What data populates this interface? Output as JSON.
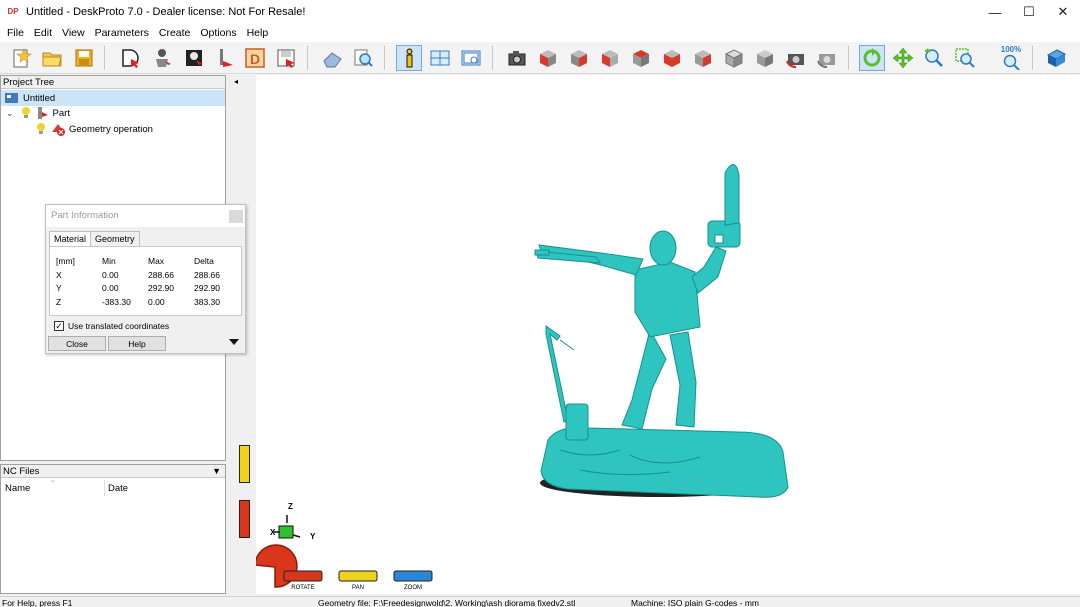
{
  "window": {
    "title": "Untitled - DeskProto 7.0 - Dealer license: Not For Resale!",
    "app_icon": "DP",
    "controls": [
      "—",
      "☐",
      "✕"
    ]
  },
  "menu": [
    "File",
    "Edit",
    "View",
    "Parameters",
    "Create",
    "Options",
    "Help"
  ],
  "toolbar": {
    "icons": [
      "new-file-icon",
      "open-folder-icon",
      "save-icon",
      "d-import-icon",
      "part-move-icon",
      "photo-icon",
      "d-tool-icon",
      "d-letter-icon",
      "save-as-icon",
      "eraser-icon",
      "zoom-find-icon",
      "info-icon",
      "layout-icon",
      "screen-icon",
      "camera-icon",
      "view-cube-1",
      "view-cube-2",
      "view-cube-3",
      "view-cube-4",
      "view-cube-5",
      "view-cube-6",
      "view-cube-7",
      "view-cube-8",
      "camera-rotate-icon",
      "camera-gray-icon",
      "rotate-icon",
      "pan-icon",
      "zoom-icon",
      "zoom-window-icon",
      "zoom-100-icon",
      "book-icon"
    ],
    "zoom_label": "100%"
  },
  "project_tree": {
    "header": "Project Tree",
    "root": "Untitled",
    "part": "Part",
    "operation": "Geometry operation"
  },
  "nc_files": {
    "header": "NC Files",
    "col_name": "Name",
    "col_date": "Date"
  },
  "part_info": {
    "title": "Part Information",
    "tabs": [
      "Material",
      "Geometry"
    ],
    "headers": [
      "[mm]",
      "Min",
      "Max",
      "Delta"
    ],
    "rows": [
      [
        "X",
        "0.00",
        "288.66",
        "288.66"
      ],
      [
        "Y",
        "0.00",
        "292.90",
        "292.90"
      ],
      [
        "Z",
        "-383.30",
        "0.00",
        "383.30"
      ]
    ],
    "checkbox_label": "Use translated coordinates",
    "checkbox_checked": true,
    "close_label": "Close",
    "help_label": "Help"
  },
  "viewport": {
    "axis_x": "X",
    "axis_y": "Y",
    "axis_z": "Z",
    "rotate_label": "ROTATE",
    "pan_label": "PAN",
    "zoom_label": "ZOOM",
    "model_color": "#2ec4bf"
  },
  "status": {
    "help": "For Help, press F1",
    "geometry": "Geometry file: F:\\Freedesignwold\\2. Working\\ash diorama fixedv2.stl",
    "machine": "Machine: ISO plain G-codes - mm"
  }
}
